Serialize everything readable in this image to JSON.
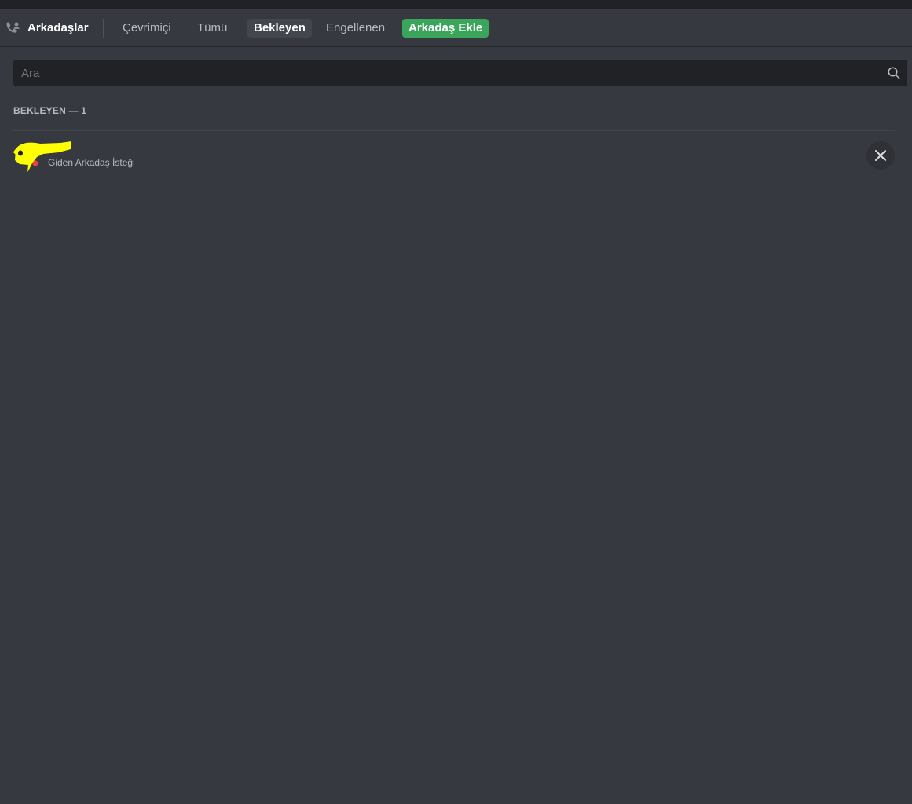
{
  "header": {
    "title": "Arkadaşlar",
    "tabs": [
      {
        "label": "Çevrimiçi",
        "selected": false
      },
      {
        "label": "Tümü",
        "selected": false
      },
      {
        "label": "Bekleyen",
        "selected": true
      },
      {
        "label": "Engellenen",
        "selected": false
      }
    ],
    "add_friend_label": "Arkadaş Ekle"
  },
  "search": {
    "placeholder": "Ara",
    "value": ""
  },
  "pending": {
    "section_title": "BEKLEYEN — 1",
    "items": [
      {
        "status_text": "Giden Arkadaş İsteği",
        "action_icon": "close-icon"
      }
    ]
  },
  "colors": {
    "background": "#36393f",
    "titlebar": "#202225",
    "add_friend_green": "#3ba55c",
    "selected_tab": "#42464d",
    "search_bg": "#202225",
    "redaction_yellow": "#ffff00"
  }
}
